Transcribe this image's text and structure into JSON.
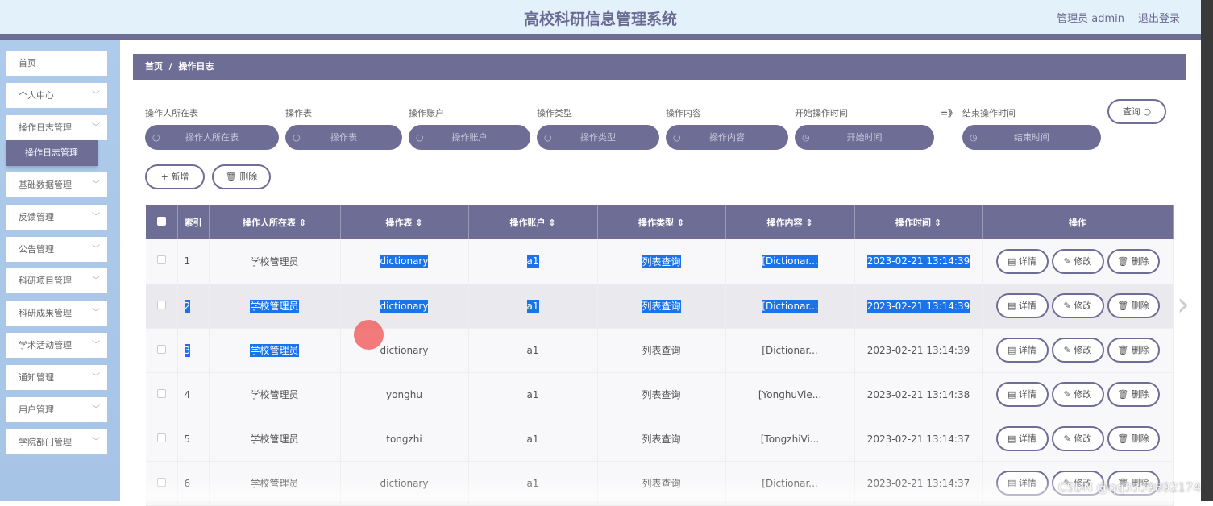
{
  "header": {
    "title": "高校科研信息管理系统",
    "user": "管理员 admin",
    "logout": "退出登录"
  },
  "sidebar": {
    "items": [
      {
        "label": "首页",
        "chevron": false
      },
      {
        "label": "个人中心",
        "chevron": true
      },
      {
        "label": "操作日志管理",
        "chevron": true
      },
      {
        "label": "基础数据管理",
        "chevron": true
      },
      {
        "label": "反馈管理",
        "chevron": true
      },
      {
        "label": "公告管理",
        "chevron": true
      },
      {
        "label": "科研项目管理",
        "chevron": true
      },
      {
        "label": "科研成果管理",
        "chevron": true
      },
      {
        "label": "学术活动管理",
        "chevron": true
      },
      {
        "label": "通知管理",
        "chevron": true
      },
      {
        "label": "用户管理",
        "chevron": true
      },
      {
        "label": "学院部门管理",
        "chevron": true
      }
    ],
    "active_sub": "操作日志管理"
  },
  "breadcrumb": {
    "home": "首页",
    "sep": "/",
    "current": "操作日志"
  },
  "filters": [
    {
      "label": "操作人所在表",
      "placeholder": "操作人所在表",
      "icon": "search-icon"
    },
    {
      "label": "操作表",
      "placeholder": "操作表",
      "icon": "search-icon"
    },
    {
      "label": "操作账户",
      "placeholder": "操作账户",
      "icon": "search-icon"
    },
    {
      "label": "操作类型",
      "placeholder": "操作类型",
      "icon": "search-icon"
    },
    {
      "label": "操作内容",
      "placeholder": "操作内容",
      "icon": "search-icon"
    },
    {
      "label": "开始操作时间",
      "placeholder": "开始时间",
      "icon": "clock-icon"
    },
    {
      "label": "结束操作时间",
      "placeholder": "结束时间",
      "icon": "clock-icon"
    }
  ],
  "range_sep": "=》",
  "query_button": "查询 ○",
  "actions": {
    "add": "+ 新增",
    "delete": "🗑 删除"
  },
  "table": {
    "headers": [
      "索引",
      "操作人所在表 ⇕",
      "操作表 ⇕",
      "操作账户 ⇕",
      "操作类型 ⇕",
      "操作内容 ⇕",
      "操作时间 ⇕",
      "操作"
    ],
    "row_buttons": {
      "detail": "▤ 详情",
      "edit": "✎ 修改",
      "delete": "🗑 删除"
    },
    "rows": [
      [
        "1",
        "学校管理员",
        "dictionary",
        "a1",
        "列表查询",
        "[Dictionar...",
        "2023-02-21 13:14:39"
      ],
      [
        "2",
        "学校管理员",
        "dictionary",
        "a1",
        "列表查询",
        "[Dictionar...",
        "2023-02-21 13:14:39"
      ],
      [
        "3",
        "学校管理员",
        "dictionary",
        "a1",
        "列表查询",
        "[Dictionar...",
        "2023-02-21 13:14:39"
      ],
      [
        "4",
        "学校管理员",
        "yonghu",
        "a1",
        "列表查询",
        "[YonghuVie...",
        "2023-02-21 13:14:38"
      ],
      [
        "5",
        "学校管理员",
        "tongzhi",
        "a1",
        "列表查询",
        "[TongzhiVi...",
        "2023-02-21 13:14:37"
      ],
      [
        "6",
        "学校管理员",
        "dictionary",
        "a1",
        "列表查询",
        "[Dictionar...",
        "2023-02-21 13:14:37"
      ]
    ]
  },
  "watermark": "CSDN @qq3359892174",
  "colors": {
    "primary": "#6e6d96",
    "header_bg": "#e3f1fb",
    "sidebar_bg": "#aecbeb",
    "selection": "#1a73e8"
  }
}
